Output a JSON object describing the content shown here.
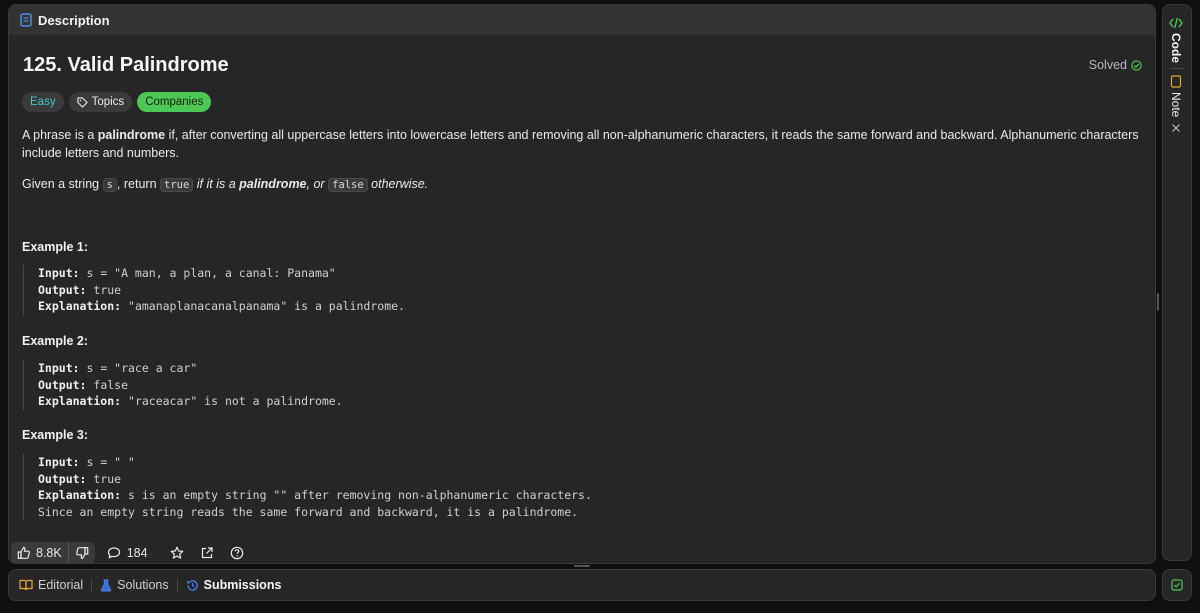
{
  "header": {
    "tab_title": "Description"
  },
  "problem": {
    "title": "125. Valid Palindrome",
    "status": "Solved",
    "badges": {
      "difficulty": "Easy",
      "topics": "Topics",
      "companies": "Companies"
    },
    "desc1": {
      "p1": "A phrase is a ",
      "bold1": "palindrome",
      "p2": " if, after converting all uppercase letters into lowercase letters and removing all non-alphanumeric characters, it reads the same forward and backward. Alphanumeric characters include letters and numbers."
    },
    "desc2": {
      "p1": "Given a string ",
      "code1": "s",
      "p2": ", return ",
      "code2": "true",
      "em1": " if it is a ",
      "bold1": "palindrome",
      "em2": ", or ",
      "code3": "false",
      "em3": " otherwise."
    }
  },
  "examples": [
    {
      "title": "Example 1:",
      "input_label": "Input:",
      "input": " s = \"A man, a plan, a canal: Panama\"",
      "output_label": "Output:",
      "output": " true",
      "explanation_label": "Explanation:",
      "explanation": " \"amanaplanacanalpanama\" is a palindrome."
    },
    {
      "title": "Example 2:",
      "input_label": "Input:",
      "input": " s = \"race a car\"",
      "output_label": "Output:",
      "output": " false",
      "explanation_label": "Explanation:",
      "explanation": " \"raceacar\" is not a palindrome."
    },
    {
      "title": "Example 3:",
      "input_label": "Input:",
      "input": " s = \" \"",
      "output_label": "Output:",
      "output": " true",
      "explanation_label": "Explanation:",
      "explanation": " s is an empty string \"\" after removing non-alphanumeric characters.",
      "explanation_cont": "Since an empty string reads the same forward and backward, it is a palindrome."
    }
  ],
  "footer": {
    "likes": "8.8K",
    "comments": "184"
  },
  "bottom_tabs": {
    "editorial": "Editorial",
    "solutions": "Solutions",
    "submissions": "Submissions"
  },
  "side_tabs": {
    "code": "Code",
    "note": "Note"
  },
  "colors": {
    "accent_green": "#4fc757",
    "easy_teal": "#46c6c2",
    "panel_bg": "#262626",
    "page_bg": "#0f0f0f"
  }
}
